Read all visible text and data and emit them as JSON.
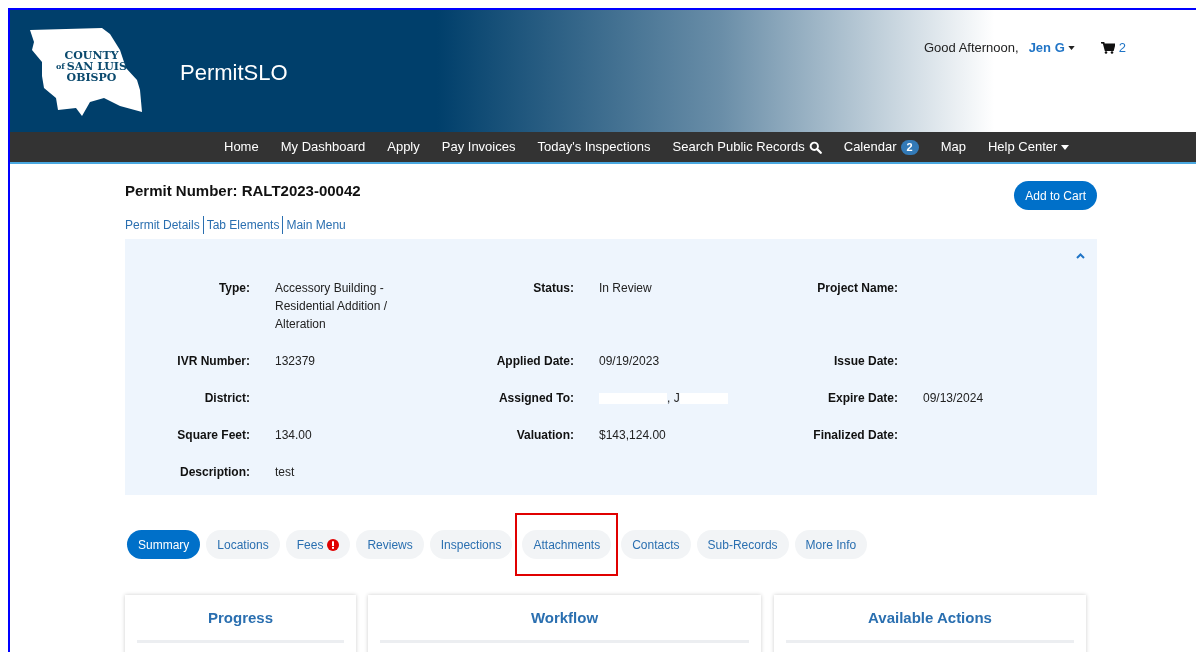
{
  "header": {
    "logo_lines": [
      "COUNTY",
      "of",
      "SAN LUIS",
      "OBISPO"
    ],
    "site_name": "PermitSLO",
    "greeting": "Good Afternoon,",
    "user": "Jen G",
    "cart_count": "2"
  },
  "nav": [
    {
      "label": "Home",
      "kind": "plain"
    },
    {
      "label": "My Dashboard",
      "kind": "plain"
    },
    {
      "label": "Apply",
      "kind": "plain"
    },
    {
      "label": "Pay Invoices",
      "kind": "plain"
    },
    {
      "label": "Today's Inspections",
      "kind": "plain"
    },
    {
      "label": "Search Public Records",
      "kind": "search"
    },
    {
      "label": "Calendar",
      "kind": "badge",
      "badge": "2"
    },
    {
      "label": "Map",
      "kind": "plain"
    },
    {
      "label": "Help Center",
      "kind": "dropdown"
    }
  ],
  "permit": {
    "title": "Permit Number: RALT2023-00042",
    "add_button": "Add to Cart",
    "links": [
      "Permit Details",
      "Tab Elements",
      "Main Menu"
    ],
    "expanded": true
  },
  "details": [
    {
      "label": "Type:",
      "value": "Accessory Building - Residential Addition / Alteration"
    },
    {
      "label": "Status:",
      "value": "In Review"
    },
    {
      "label": "Project Name:"
    },
    {
      "label": "IVR Number:",
      "value": "132379"
    },
    {
      "label": "Applied Date:",
      "value": "09/19/2023"
    },
    {
      "label": "Issue Date:"
    },
    {
      "label": "District:"
    },
    {
      "label": "Assigned To:",
      "value": ", J",
      "redacted": true
    },
    {
      "label": "Expire Date:",
      "value": "09/13/2024"
    },
    {
      "label": "Square Feet:",
      "value": "134.00"
    },
    {
      "label": "Valuation:",
      "value": "$143,124.00"
    },
    {
      "label": "Finalized Date:"
    },
    {
      "label": "Description:",
      "value": "test"
    }
  ],
  "tabs": [
    {
      "label": "Summary",
      "selected": true,
      "alert": false,
      "highlighted": false
    },
    {
      "label": "Locations",
      "selected": false,
      "alert": false,
      "highlighted": false
    },
    {
      "label": "Fees",
      "selected": false,
      "alert": true,
      "highlighted": false
    },
    {
      "label": "Reviews",
      "selected": false,
      "alert": false,
      "highlighted": false
    },
    {
      "label": "Inspections",
      "selected": false,
      "alert": false,
      "highlighted": false
    },
    {
      "label": "Attachments",
      "selected": false,
      "alert": false,
      "highlighted": true
    },
    {
      "label": "Contacts",
      "selected": false,
      "alert": false,
      "highlighted": false
    },
    {
      "label": "Sub-Records",
      "selected": false,
      "alert": false,
      "highlighted": false
    },
    {
      "label": "More Info",
      "selected": false,
      "alert": false,
      "highlighted": false
    }
  ],
  "panels": [
    "Progress",
    "Workflow",
    "Available Actions"
  ]
}
